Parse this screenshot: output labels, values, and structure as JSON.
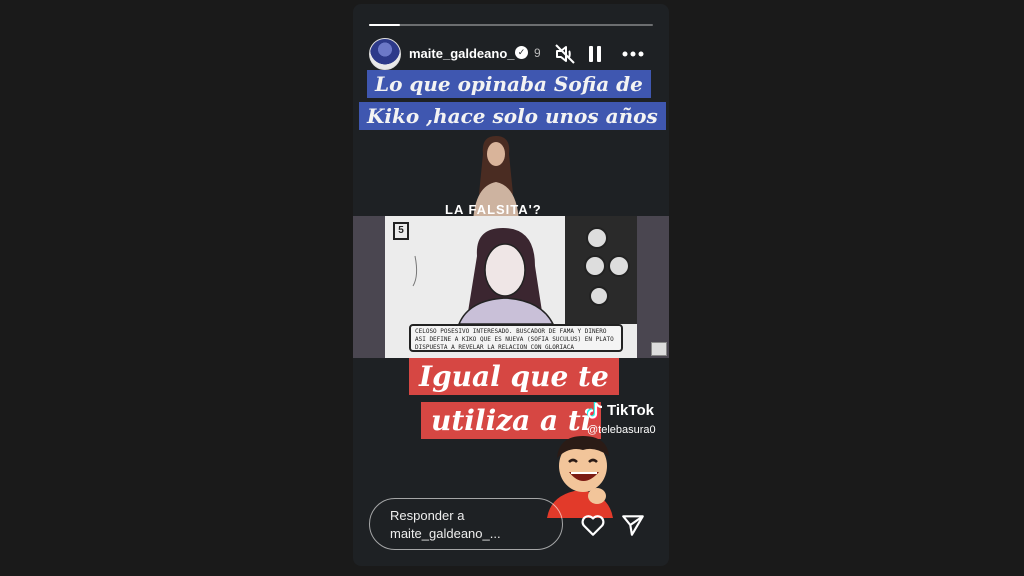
{
  "story": {
    "progress": 0.11,
    "username": "maite_galdeano_",
    "timestamp": "9",
    "banner_line1": "Lo que opinaba Sofia de",
    "banner_line2": "Kiko ,hace solo unos años",
    "falsita_text": "LA FALSITA'?",
    "clip_channel": "5",
    "clip_caption": "CELOSO POSESIVO INTERESADO. BUSCADOR DE FAMA Y DINERO ASI DEFINE A KIKO QUE ES NUEVA (SOFIA SUCULUS) EN PLATO DISPUESTA A REVELAR LA RELACION CON GLORIACA",
    "red_line1": "Igual que te",
    "red_line2": "utiliza a ti",
    "tiktok_label": "TikTok",
    "tiktok_handle": "@telebasura0",
    "reply_placeholder": "Responder a maite_galdeano_..."
  },
  "icons": [
    "verified-icon",
    "mute-icon",
    "pause-icon",
    "more-icon",
    "tiktok-icon",
    "heart-icon",
    "send-icon"
  ]
}
